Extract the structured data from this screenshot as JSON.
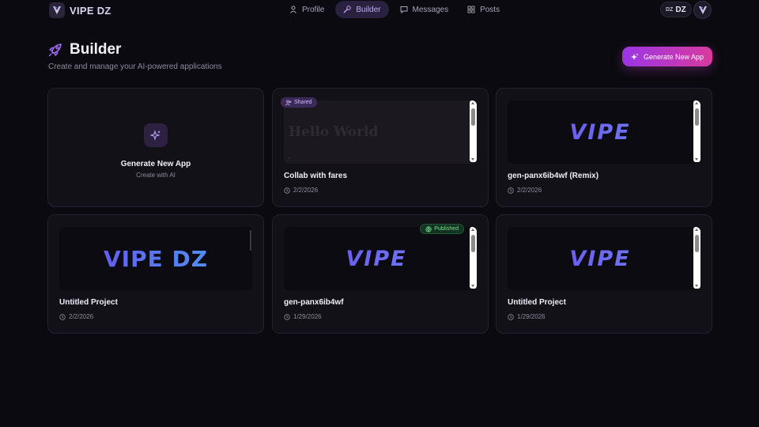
{
  "brand": {
    "name": "VIPE DZ"
  },
  "nav": [
    {
      "label": "Profile",
      "icon": "user-icon",
      "active": false
    },
    {
      "label": "Builder",
      "icon": "wrench-icon",
      "active": true
    },
    {
      "label": "Messages",
      "icon": "message-icon",
      "active": false
    },
    {
      "label": "Posts",
      "icon": "grid-icon",
      "active": false
    }
  ],
  "user": {
    "small": "DZ",
    "label": "DZ"
  },
  "header": {
    "title": "Builder",
    "subtitle": "Create and manage your AI-powered applications",
    "generate_button": "Generate New App"
  },
  "new_card": {
    "title": "Generate New App",
    "subtitle": "Create with AI"
  },
  "projects": [
    {
      "title": "Collab with fares",
      "date": "2/2/2026",
      "badge": "Shared",
      "preview": "Hello World",
      "preview_stars": "★★★"
    },
    {
      "title": "gen-panx6ib4wf (Remix)",
      "date": "2/2/2026",
      "preview": "VIPE"
    },
    {
      "title": "Untitled Project",
      "date": "2/2/2026",
      "preview": "VIPE DZ"
    },
    {
      "title": "gen-panx6ib4wf",
      "date": "1/29/2026",
      "badge": "Published",
      "preview": "VIPE"
    },
    {
      "title": "Untitled Project",
      "date": "1/29/2026",
      "preview": "VIPE"
    }
  ],
  "colors": {
    "accent": "#9a36e6",
    "accent2": "#d93a9d",
    "published": "#6fe08f"
  }
}
